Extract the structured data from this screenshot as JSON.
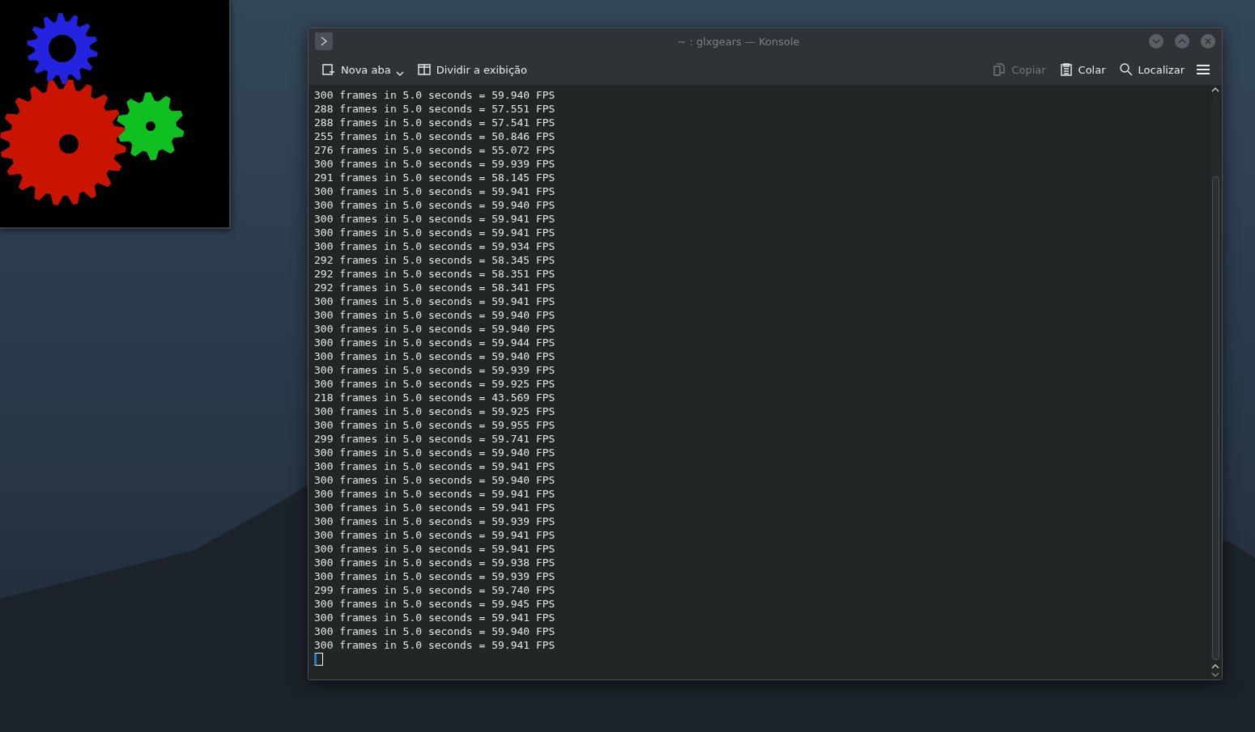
{
  "window": {
    "title": "~ : glxgears — Konsole"
  },
  "toolbar": {
    "left": [
      {
        "kind": "newtab",
        "label": "Nova aba",
        "disabled": false
      },
      {
        "kind": "split",
        "label": "Dividir a exibição",
        "disabled": false
      }
    ],
    "right": [
      {
        "kind": "copy",
        "label": "Copiar",
        "disabled": true
      },
      {
        "kind": "paste",
        "label": "Colar",
        "disabled": false
      },
      {
        "kind": "find",
        "label": "Localizar",
        "disabled": false
      }
    ]
  },
  "terminal": {
    "lines": [
      "300 frames in 5.0 seconds = 59.940 FPS",
      "288 frames in 5.0 seconds = 57.551 FPS",
      "288 frames in 5.0 seconds = 57.541 FPS",
      "255 frames in 5.0 seconds = 50.846 FPS",
      "276 frames in 5.0 seconds = 55.072 FPS",
      "300 frames in 5.0 seconds = 59.939 FPS",
      "291 frames in 5.0 seconds = 58.145 FPS",
      "300 frames in 5.0 seconds = 59.941 FPS",
      "300 frames in 5.0 seconds = 59.940 FPS",
      "300 frames in 5.0 seconds = 59.941 FPS",
      "300 frames in 5.0 seconds = 59.941 FPS",
      "300 frames in 5.0 seconds = 59.934 FPS",
      "292 frames in 5.0 seconds = 58.345 FPS",
      "292 frames in 5.0 seconds = 58.351 FPS",
      "292 frames in 5.0 seconds = 58.341 FPS",
      "300 frames in 5.0 seconds = 59.941 FPS",
      "300 frames in 5.0 seconds = 59.940 FPS",
      "300 frames in 5.0 seconds = 59.940 FPS",
      "300 frames in 5.0 seconds = 59.944 FPS",
      "300 frames in 5.0 seconds = 59.940 FPS",
      "300 frames in 5.0 seconds = 59.939 FPS",
      "300 frames in 5.0 seconds = 59.925 FPS",
      "218 frames in 5.0 seconds = 43.569 FPS",
      "300 frames in 5.0 seconds = 59.925 FPS",
      "300 frames in 5.0 seconds = 59.955 FPS",
      "299 frames in 5.0 seconds = 59.741 FPS",
      "300 frames in 5.0 seconds = 59.940 FPS",
      "300 frames in 5.0 seconds = 59.941 FPS",
      "300 frames in 5.0 seconds = 59.940 FPS",
      "300 frames in 5.0 seconds = 59.941 FPS",
      "300 frames in 5.0 seconds = 59.941 FPS",
      "300 frames in 5.0 seconds = 59.939 FPS",
      "300 frames in 5.0 seconds = 59.941 FPS",
      "300 frames in 5.0 seconds = 59.941 FPS",
      "300 frames in 5.0 seconds = 59.938 FPS",
      "300 frames in 5.0 seconds = 59.939 FPS",
      "299 frames in 5.0 seconds = 59.740 FPS",
      "300 frames in 5.0 seconds = 59.945 FPS",
      "300 frames in 5.0 seconds = 59.941 FPS",
      "300 frames in 5.0 seconds = 59.940 FPS",
      "300 frames in 5.0 seconds = 59.941 FPS"
    ]
  }
}
